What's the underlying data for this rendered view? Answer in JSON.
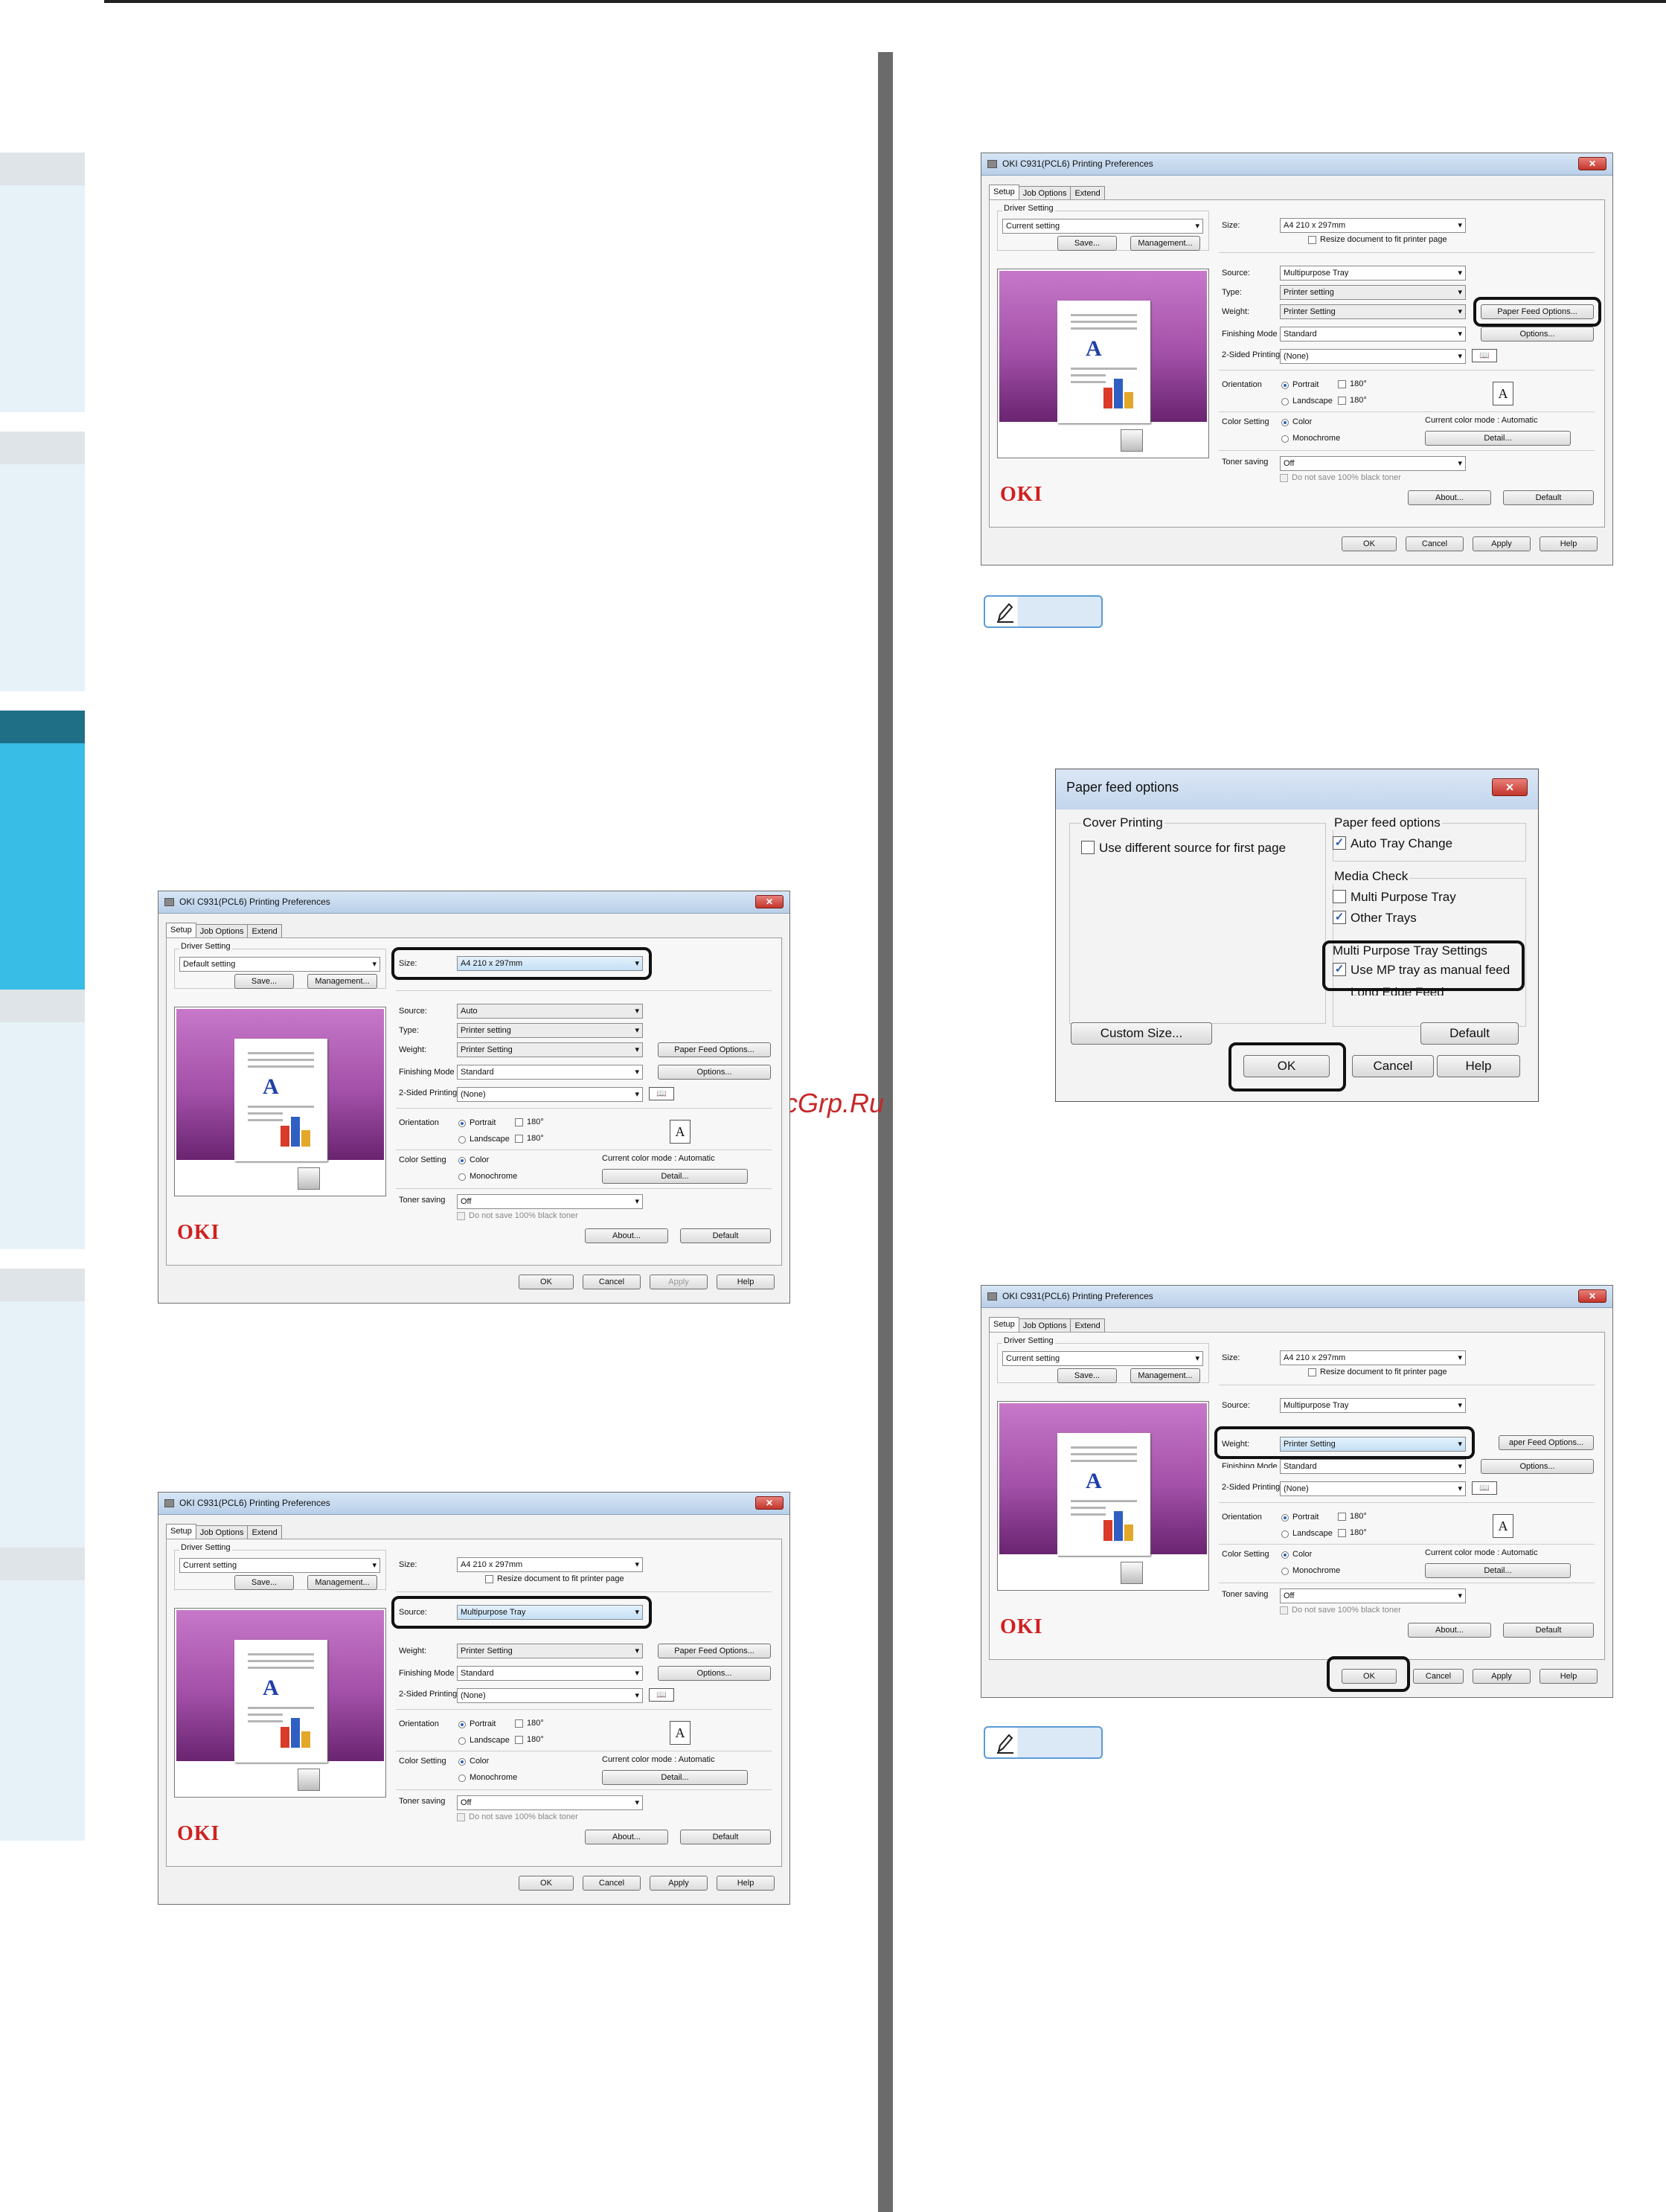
{
  "watermark": "McGrp.Ru",
  "colors": {
    "tab_active_header": "#1f6f86",
    "tab_active_body": "#38bde6",
    "tab_inactive": "#e6f2f8",
    "oki_red": "#d02020",
    "center_bar": "#6b6b6b"
  },
  "pref_dialog": {
    "title": "OKI C931(PCL6) Printing Preferences",
    "tabs": [
      "Setup",
      "Job Options",
      "Extend"
    ],
    "driver_setting_label": "Driver Setting",
    "save_btn": "Save...",
    "management_btn": "Management...",
    "size_label": "Size:",
    "resize_label": "Resize document to fit printer page",
    "source_label": "Source:",
    "type_label": "Type:",
    "weight_label": "Weight:",
    "paper_feed_btn": "Paper Feed Options...",
    "finishing_label": "Finishing Mode",
    "finishing_value": "Standard",
    "options_btn": "Options...",
    "twosided_label": "2-Sided Printing",
    "twosided_value": "(None)",
    "orientation_label": "Orientation",
    "portrait": "Portrait",
    "landscape": "Landscape",
    "rot180": "180°",
    "color_setting_label": "Color Setting",
    "color": "Color",
    "monochrome": "Monochrome",
    "color_mode": "Current color mode : Automatic",
    "detail_btn": "Detail...",
    "toner_label": "Toner saving",
    "toner_value": "Off",
    "black_toner": "Do not save 100% black toner",
    "about_btn": "About...",
    "default_btn": "Default",
    "ok_btn": "OK",
    "cancel_btn": "Cancel",
    "apply_btn": "Apply",
    "help_btn": "Help",
    "logo": "OKI",
    "doc_letter": "A",
    "book_icon": "📖",
    "orient_letter": "A"
  },
  "dialog_a": {
    "driver": "Current setting",
    "size": "A4 210 x 297mm",
    "source": "Multipurpose Tray",
    "type": "Printer setting",
    "weight": "Printer Setting"
  },
  "dialog_b": {
    "driver": "Default setting",
    "size": "A4 210 x 297mm",
    "source": "Auto",
    "type": "Printer setting",
    "weight": "Printer Setting"
  },
  "dialog_c": {
    "driver": "Current setting",
    "size": "A4 210 x 297mm",
    "source": "Multipurpose Tray",
    "type": "Printer setting",
    "weight": "Printer Setting"
  },
  "dialog_d": {
    "driver": "Current setting",
    "size": "A4 210 x 297mm",
    "source": "Multipurpose Tray",
    "type": "Printer setting",
    "weight": "Printer Setting",
    "paper_feed_partial": "aper Feed Options..."
  },
  "paper_feed": {
    "title": "Paper feed options",
    "close": "✕",
    "cover_printing": "Cover Printing",
    "use_diff_source": "Use different source for first page",
    "pf_options": "Paper feed options",
    "auto_tray": "Auto Tray Change",
    "media_check": "Media Check",
    "multi_purpose": "Multi Purpose Tray",
    "other_trays": "Other Trays",
    "mp_settings": "Multi Purpose Tray Settings",
    "use_mp": "Use MP tray as manual feed",
    "long_edge": "Long Edge Feed",
    "custom_size": "Custom Size...",
    "default": "Default",
    "ok": "OK",
    "cancel": "Cancel",
    "help": "Help",
    "check_mark": "✓"
  }
}
